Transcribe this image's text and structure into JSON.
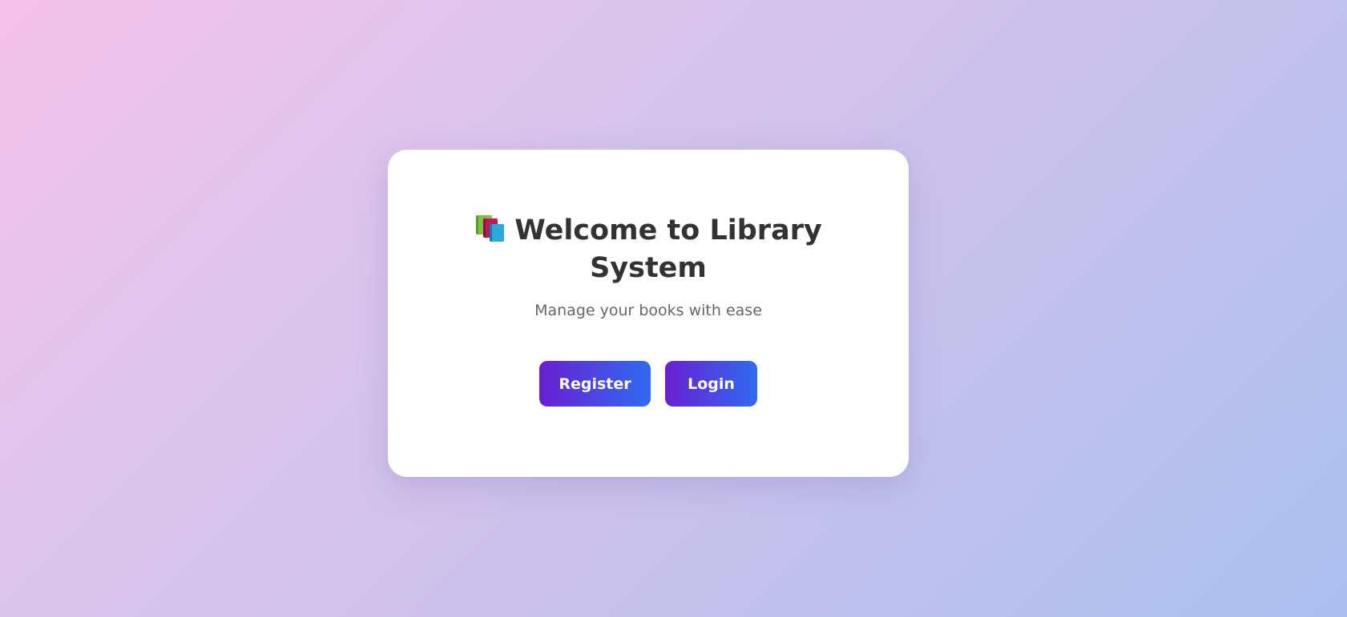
{
  "card": {
    "title_line1": "Welcome to Library",
    "title_line2": "System",
    "title_icon": "books-icon",
    "subtitle": "Manage your books with ease"
  },
  "actions": {
    "register_label": "Register",
    "login_label": "Login"
  },
  "colors": {
    "button_gradient_start": "#6a1fd1",
    "button_gradient_end": "#2f6bf0",
    "title": "#333333",
    "subtitle": "#666666"
  }
}
